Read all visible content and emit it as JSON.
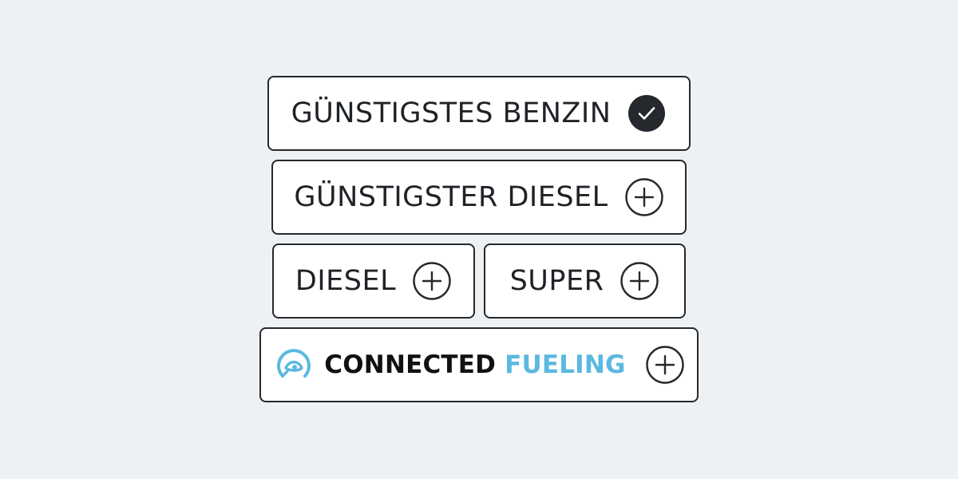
{
  "colors": {
    "background": "#eef1f3",
    "chip_border": "#25282d",
    "text": "#1f2227",
    "brand_blue": "#5bb9df",
    "check_fill": "#25282d"
  },
  "filters": [
    {
      "label": "GÜNSTIGSTES BENZIN",
      "state": "selected",
      "icon": "check-circle-icon"
    },
    {
      "label": "GÜNSTIGSTER DIESEL",
      "state": "unselected",
      "icon": "plus-circle-icon"
    },
    {
      "label": "DIESEL",
      "state": "unselected",
      "icon": "plus-circle-icon"
    },
    {
      "label": "SUPER",
      "state": "unselected",
      "icon": "plus-circle-icon"
    }
  ],
  "connected_fueling": {
    "word1": "CONNECTED",
    "word2": "FUELING",
    "state": "unselected",
    "icon": "plus-circle-icon",
    "logo_icon": "connected-fueling-logo-icon"
  }
}
